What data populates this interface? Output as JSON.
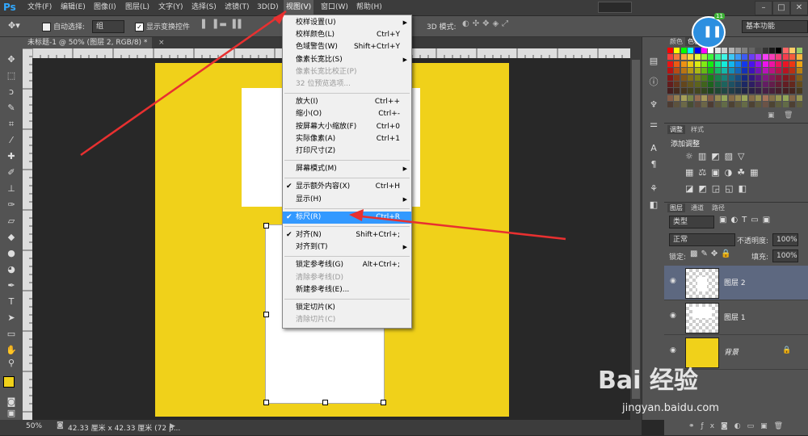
{
  "app": {
    "logo": "Ps"
  },
  "menubar": {
    "items": [
      "文件(F)",
      "编辑(E)",
      "图像(I)",
      "图层(L)",
      "文字(Y)",
      "选择(S)",
      "滤镜(T)",
      "3D(D)",
      "视图(V)",
      "窗口(W)",
      "帮助(H)"
    ]
  },
  "optionsbar": {
    "auto_select_label": "自动选择:",
    "auto_select_value": "组",
    "show_transform_label": "显示变换控件",
    "mode_3d_label": "3D 模式:",
    "workspace_value": "基本功能"
  },
  "document": {
    "tab_title": "未标题-1 @ 50% (图层 2, RGB/8) *",
    "doc_color": "#f0d11a"
  },
  "status": {
    "zoom": "50%",
    "info": "42.33 厘米 x 42.33 厘米 (72 p..."
  },
  "view_menu": {
    "items": [
      {
        "label": "校样设置(U)",
        "shortcut": "",
        "sub": true,
        "dis": false,
        "chk": false
      },
      {
        "label": "校样颜色(L)",
        "shortcut": "Ctrl+Y",
        "sub": false,
        "dis": false,
        "chk": false
      },
      {
        "label": "色域警告(W)",
        "shortcut": "Shift+Ctrl+Y",
        "sub": false,
        "dis": false,
        "chk": false
      },
      {
        "label": "像素长宽比(S)",
        "shortcut": "",
        "sub": true,
        "dis": false,
        "chk": false
      },
      {
        "label": "像素长宽比校正(P)",
        "shortcut": "",
        "sub": false,
        "dis": true,
        "chk": false
      },
      {
        "label": "32 位预览选项...",
        "shortcut": "",
        "sub": false,
        "dis": true,
        "chk": false
      },
      {
        "label": "放大(I)",
        "shortcut": "Ctrl++",
        "sub": false,
        "dis": false,
        "chk": false
      },
      {
        "label": "缩小(O)",
        "shortcut": "Ctrl+-",
        "sub": false,
        "dis": false,
        "chk": false
      },
      {
        "label": "按屏幕大小缩放(F)",
        "shortcut": "Ctrl+0",
        "sub": false,
        "dis": false,
        "chk": false
      },
      {
        "label": "实际像素(A)",
        "shortcut": "Ctrl+1",
        "sub": false,
        "dis": false,
        "chk": false
      },
      {
        "label": "打印尺寸(Z)",
        "shortcut": "",
        "sub": false,
        "dis": false,
        "chk": false
      },
      {
        "label": "屏幕模式(M)",
        "shortcut": "",
        "sub": true,
        "dis": false,
        "chk": false
      },
      {
        "label": "显示额外内容(X)",
        "shortcut": "Ctrl+H",
        "sub": false,
        "dis": false,
        "chk": true
      },
      {
        "label": "显示(H)",
        "shortcut": "",
        "sub": true,
        "dis": false,
        "chk": false
      },
      {
        "label": "标尺(R)",
        "shortcut": "Ctrl+R",
        "sub": false,
        "dis": false,
        "chk": true,
        "hl": true
      },
      {
        "label": "对齐(N)",
        "shortcut": "Shift+Ctrl+;",
        "sub": false,
        "dis": false,
        "chk": true
      },
      {
        "label": "对齐到(T)",
        "shortcut": "",
        "sub": true,
        "dis": false,
        "chk": false
      },
      {
        "label": "锁定参考线(G)",
        "shortcut": "Alt+Ctrl+;",
        "sub": false,
        "dis": false,
        "chk": false
      },
      {
        "label": "清除参考线(D)",
        "shortcut": "",
        "sub": false,
        "dis": true,
        "chk": false
      },
      {
        "label": "新建参考线(E)...",
        "shortcut": "",
        "sub": false,
        "dis": false,
        "chk": false
      },
      {
        "label": "锁定切片(K)",
        "shortcut": "",
        "sub": false,
        "dis": false,
        "chk": false
      },
      {
        "label": "清除切片(C)",
        "shortcut": "",
        "sub": false,
        "dis": true,
        "chk": false
      }
    ]
  },
  "panels": {
    "color_tab": "颜色",
    "swatches_tab": "色板",
    "adjust_tab": "调整",
    "styles_tab": "样式",
    "add_adjustment": "添加调整",
    "layers_tab": "图层",
    "channels_tab": "通道",
    "paths_tab": "路径",
    "kind_filter": "类型",
    "blend_mode": "正常",
    "opacity_label": "不透明度:",
    "opacity_value": "100%",
    "lock_label": "锁定:",
    "fill_label": "填充:",
    "fill_value": "100%",
    "layers": [
      {
        "name": "图层 2",
        "selected": true
      },
      {
        "name": "图层 1",
        "selected": false
      },
      {
        "name": "背景",
        "selected": false
      }
    ]
  },
  "widget": {
    "badge": "11"
  },
  "watermark": {
    "brand": "Bai 经验",
    "url": "jingyan.baidu.com"
  }
}
